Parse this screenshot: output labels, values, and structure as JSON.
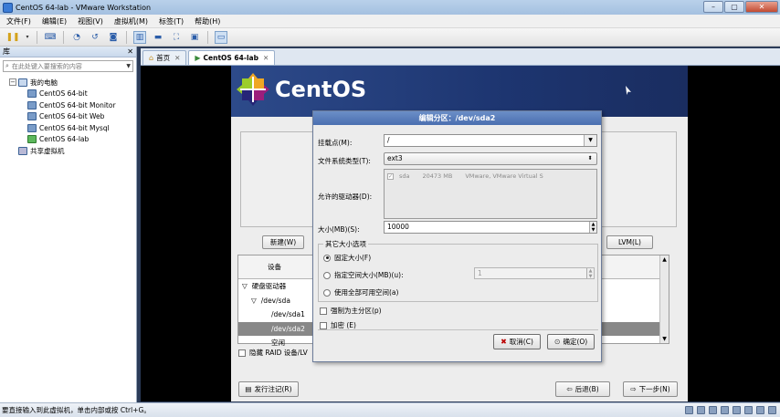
{
  "window": {
    "title": "CentOS 64-lab - VMware Workstation",
    "minimize": "–",
    "maximize": "▢",
    "close": "✕"
  },
  "menu": [
    "文件(F)",
    "编辑(E)",
    "视图(V)",
    "虚拟机(M)",
    "标签(T)",
    "帮助(H)"
  ],
  "library": {
    "title": "库",
    "close": "✕",
    "search_placeholder": "在此处键入要搜索的内容",
    "root": "我的电脑",
    "vms": [
      "CentOS 64-bit",
      "CentOS 64-bit Monitor",
      "CentOS 64-bit Web",
      "CentOS 64-bit Mysql",
      "CentOS 64-lab"
    ],
    "shared": "共享虚拟机"
  },
  "tabs": {
    "home": "首页",
    "vm": "CentOS 64-lab",
    "close": "✕"
  },
  "guest": {
    "brand": "CentOS",
    "buttons": {
      "new": "新建(W)",
      "lvm": "LVM(L)",
      "release_notes": "发行注记(R)",
      "back": "后退(B)",
      "next": "下一步(N)"
    },
    "device_header": "设备",
    "devices": [
      {
        "label": "硬盘驱动器",
        "indent": 0,
        "expander": "▽"
      },
      {
        "label": "/dev/sda",
        "indent": 1,
        "expander": "▽"
      },
      {
        "label": "/dev/sda1",
        "indent": 2,
        "expander": ""
      },
      {
        "label": "/dev/sda2",
        "indent": 2,
        "expander": "",
        "selected": true
      },
      {
        "label": "空闲",
        "indent": 2,
        "expander": ""
      }
    ],
    "hide_raid": "隐藏 RAID 设备/LV"
  },
  "dialog": {
    "title": "编辑分区：/dev/sda2",
    "mount_label": "挂载点(M):",
    "mount_value": "/",
    "fstype_label": "文件系统类型(T):",
    "fstype_value": "ext3",
    "drives_label": "允许的驱动器(D):",
    "drive": {
      "name": "sda",
      "size": "20473 MB",
      "model": "VMware, VMware Virtual S"
    },
    "size_label": "大小(MB)(S):",
    "size_value": "10000",
    "other_group": "其它大小选项",
    "opt_fixed": "固定大小(F)",
    "opt_upto": "指定空间大小(MB)(u):",
    "opt_upto_value": "1",
    "opt_fill": "使用全部可用空间(a)",
    "force_primary": "强制为主分区(p)",
    "encrypt": "加密 (E)",
    "cancel": "取消(C)",
    "ok": "确定(O)"
  },
  "status": {
    "message": "要直接输入到此虚拟机，单击内部或按 Ctrl+G。"
  }
}
